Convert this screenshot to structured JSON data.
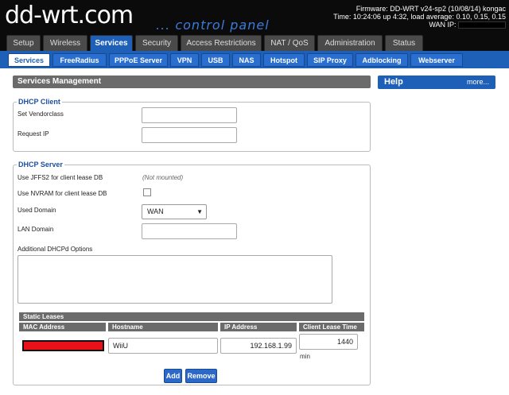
{
  "header": {
    "logo": "dd-wrt.com",
    "tagline": "... control panel",
    "firmware": "Firmware: DD-WRT v24-sp2 (10/08/14) kongac",
    "time": "Time: 10:24:06 up 4:32, load average: 0.10, 0.15, 0.15",
    "wan_ip_label": "WAN IP:"
  },
  "tabs": [
    "Setup",
    "Wireless",
    "Services",
    "Security",
    "Access Restrictions",
    "NAT / QoS",
    "Administration",
    "Status"
  ],
  "subtabs": [
    "Services",
    "FreeRadius",
    "PPPoE Server",
    "VPN",
    "USB",
    "NAS",
    "Hotspot",
    "SIP Proxy",
    "Adblocking",
    "Webserver"
  ],
  "main": {
    "title": "Services Management",
    "help_title": "Help",
    "help_more": "more..."
  },
  "dhcp_client": {
    "legend": "DHCP Client",
    "vendorclass_label": "Set Vendorclass",
    "vendorclass_value": "",
    "request_ip_label": "Request IP",
    "request_ip_value": ""
  },
  "dhcp_server": {
    "legend": "DHCP Server",
    "jffs2_label": "Use JFFS2 for client lease DB",
    "jffs2_note": "(Not mounted)",
    "nvram_label": "Use NVRAM for client lease DB",
    "nvram_checked": false,
    "used_domain_label": "Used Domain",
    "used_domain_value": "WAN",
    "lan_domain_label": "LAN Domain",
    "lan_domain_value": "",
    "dhcpd_options_label": "Additional DHCPd Options"
  },
  "static_leases": {
    "title": "Static Leases",
    "columns": [
      "MAC Address",
      "Hostname",
      "IP Address",
      "Client Lease Time"
    ],
    "row": {
      "hostname": "WiiU",
      "ip": "192.168.1.99",
      "lease_time": "1440",
      "unit": "min"
    },
    "add_label": "Add",
    "remove_label": "Remove"
  },
  "colors": {
    "accent": "#1e5fb8",
    "header_bg": "#0b0b0b",
    "panel_gray": "#6b6b6b"
  }
}
